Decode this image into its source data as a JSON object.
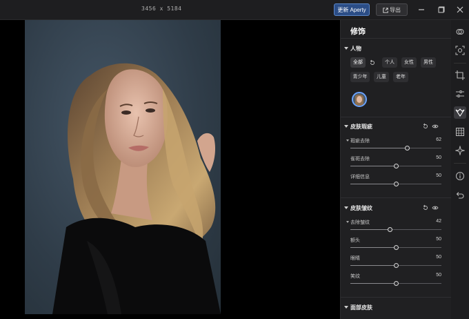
{
  "window": {
    "image_dimensions": "3456 x 5184",
    "update_label": "更新 Aperty",
    "export_label": "导出"
  },
  "panel": {
    "title": "修饰",
    "people_section": {
      "title": "人物",
      "filters": [
        {
          "label": "全部",
          "selected": true
        },
        {
          "label": "个人",
          "selected": false
        },
        {
          "label": "女性",
          "selected": false
        },
        {
          "label": "男性",
          "selected": false
        },
        {
          "label": "青少年",
          "selected": false
        },
        {
          "label": "儿童",
          "selected": false
        },
        {
          "label": "老年",
          "selected": false
        }
      ]
    },
    "skin_blemish": {
      "title": "皮肤瑕疵",
      "sliders": [
        {
          "label": "瑕疵去除",
          "value": 62
        },
        {
          "label": "雀斑去除",
          "value": 50
        },
        {
          "label": "详细信息",
          "value": 50
        }
      ]
    },
    "skin_wrinkles": {
      "title": "皮肤皱纹",
      "sliders": [
        {
          "label": "去除皱纹",
          "value": 42
        },
        {
          "label": "额头",
          "value": 50
        },
        {
          "label": "眼睛",
          "value": 50
        },
        {
          "label": "笑纹",
          "value": 50
        }
      ]
    },
    "face_skin": {
      "title": "面部皮肤"
    }
  },
  "colors": {
    "accent": "#6aa3ff",
    "update_button": "#2b4d86",
    "panel_bg": "#202022"
  }
}
